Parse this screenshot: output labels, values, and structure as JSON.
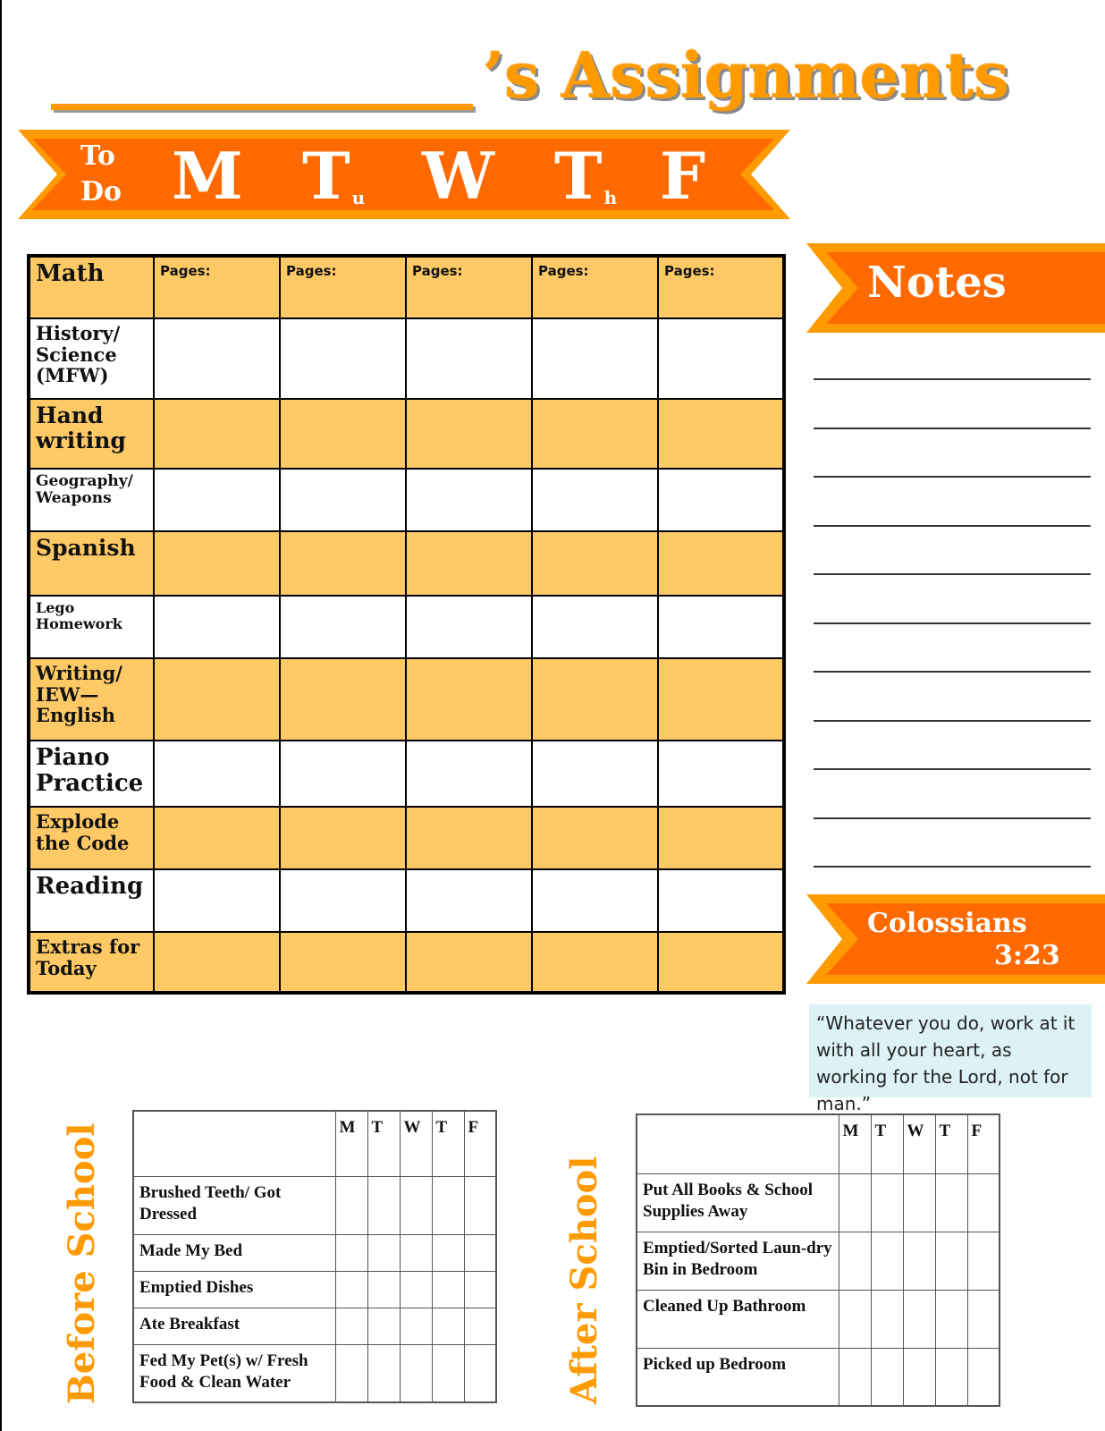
{
  "title": {
    "name_blank": "",
    "suffix": "’s Assignments"
  },
  "days_banner": {
    "todo_line1": "To",
    "todo_line2": "Do",
    "days": [
      {
        "main": "M",
        "sub": ""
      },
      {
        "main": "T",
        "sub": "u"
      },
      {
        "main": "W",
        "sub": ""
      },
      {
        "main": "T",
        "sub": "h"
      },
      {
        "main": "F",
        "sub": ""
      }
    ]
  },
  "assignments": {
    "rows": [
      {
        "subject": "Math",
        "cells": [
          "Pages:",
          "Pages:",
          "Pages:",
          "Pages:",
          "Pages:"
        ]
      },
      {
        "subject": "History/ Science (MFW)",
        "cells": [
          "",
          "",
          "",
          "",
          ""
        ]
      },
      {
        "subject": "Hand writing",
        "cells": [
          "",
          "",
          "",
          "",
          ""
        ]
      },
      {
        "subject": "Geography/ Weapons",
        "cells": [
          "",
          "",
          "",
          "",
          ""
        ]
      },
      {
        "subject": "Spanish",
        "cells": [
          "",
          "",
          "",
          "",
          ""
        ]
      },
      {
        "subject": "Lego Homework",
        "cells": [
          "",
          "",
          "",
          "",
          ""
        ]
      },
      {
        "subject": "Writing/ IEW— English",
        "cells": [
          "",
          "",
          "",
          "",
          ""
        ]
      },
      {
        "subject": "Piano Practice",
        "cells": [
          "",
          "",
          "",
          "",
          ""
        ]
      },
      {
        "subject": "Explode the Code",
        "cells": [
          "",
          "",
          "",
          "",
          ""
        ]
      },
      {
        "subject": "Reading",
        "cells": [
          "",
          "",
          "",
          "",
          ""
        ]
      },
      {
        "subject": "Extras for Today",
        "cells": [
          "",
          "",
          "",
          "",
          ""
        ]
      }
    ]
  },
  "notes": {
    "heading": "Notes",
    "line_count": 11
  },
  "verse": {
    "book": "Colossians",
    "ref": "3:23",
    "text": "“Whatever you do, work at it with all your heart, as working for the Lord, not for man.”"
  },
  "before_school": {
    "label": "Before School",
    "day_headers": [
      "M",
      "T",
      "W",
      "T",
      "F"
    ],
    "tasks": [
      "Brushed Teeth/ Got Dressed",
      "Made My Bed",
      "Emptied Dishes",
      "Ate Breakfast",
      "Fed My Pet(s) w/ Fresh Food & Clean Water"
    ]
  },
  "after_school": {
    "label": "After School",
    "day_headers": [
      "M",
      "T",
      "W",
      "T",
      "F"
    ],
    "tasks": [
      "Put All Books & School Supplies Away",
      "Emptied/Sorted Laun-dry Bin in Bedroom",
      "Cleaned Up Bathroom",
      "Picked up Bedroom"
    ]
  },
  "colors": {
    "ribbon_dark": "#ff6a00",
    "ribbon_light": "#ff9a00",
    "row_highlight": "#ffca66",
    "verse_bg": "#ddf2f7",
    "title": "#ff9a00"
  }
}
